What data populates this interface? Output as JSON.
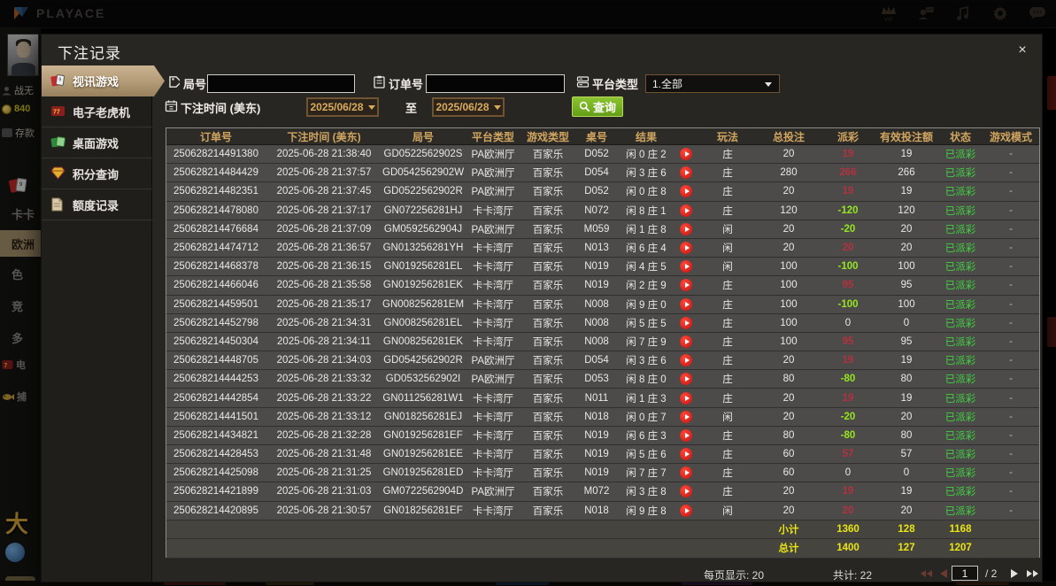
{
  "topbar": {
    "logo": "PLAYACE",
    "icons": [
      "vip-icon",
      "support-icon",
      "music-icon",
      "settings-icon",
      "chat-icon"
    ]
  },
  "sidebar": {
    "username": "战无",
    "balance": "840",
    "deposit": "存款",
    "m1": "卡卡",
    "m2": "欧洲",
    "m3": "色",
    "m4": "竞",
    "m5": "多",
    "m6": "电",
    "m7": "捕",
    "promo": "大"
  },
  "modal": {
    "title": "下注记录",
    "close_label": "×",
    "nav": [
      {
        "label": "视讯游戏",
        "active": true
      },
      {
        "label": "电子老虎机",
        "active": false
      },
      {
        "label": "桌面游戏",
        "active": false
      },
      {
        "label": "积分查询",
        "active": false
      },
      {
        "label": "额度记录",
        "active": false
      }
    ],
    "filters": {
      "round_label": "局号",
      "order_label": "订单号",
      "platform_label": "平台类型",
      "platform_value": "1.全部",
      "time_label": "下注时间 (美东)",
      "date_from": "2025/06/28",
      "to_label": "至",
      "date_to": "2025/06/28",
      "search_label": "查询"
    },
    "table": {
      "headers": [
        "订单号",
        "下注时间 (美东)",
        "局号",
        "平台类型",
        "游戏类型",
        "桌号",
        "结果",
        "",
        "玩法",
        "总投注",
        "派彩",
        "有效投注额",
        "状态",
        "游戏模式"
      ],
      "rows": [
        {
          "order": "250628214491380",
          "time": "2025-06-28 21:38:40",
          "round": "GD0522562902S",
          "platform": "PA欧洲厅",
          "game": "百家乐",
          "table": "D052",
          "result": "闲 0 庄 2",
          "play": "庄",
          "total": "20",
          "payout": "19",
          "pc": "win",
          "valid": "19",
          "status": "已派彩",
          "mode": "-"
        },
        {
          "order": "250628214484429",
          "time": "2025-06-28 21:37:57",
          "round": "GD0542562902W",
          "platform": "PA欧洲厅",
          "game": "百家乐",
          "table": "D054",
          "result": "闲 3 庄 6",
          "play": "庄",
          "total": "280",
          "payout": "266",
          "pc": "win",
          "valid": "266",
          "status": "已派彩",
          "mode": "-"
        },
        {
          "order": "250628214482351",
          "time": "2025-06-28 21:37:45",
          "round": "GD0522562902R",
          "platform": "PA欧洲厅",
          "game": "百家乐",
          "table": "D052",
          "result": "闲 0 庄 8",
          "play": "庄",
          "total": "20",
          "payout": "19",
          "pc": "win",
          "valid": "19",
          "status": "已派彩",
          "mode": "-"
        },
        {
          "order": "250628214478080",
          "time": "2025-06-28 21:37:17",
          "round": "GN072256281HJ",
          "platform": "卡卡湾厅",
          "game": "百家乐",
          "table": "N072",
          "result": "闲 8 庄 1",
          "play": "庄",
          "total": "120",
          "payout": "-120",
          "pc": "loss",
          "valid": "120",
          "status": "已派彩",
          "mode": "-"
        },
        {
          "order": "250628214476684",
          "time": "2025-06-28 21:37:09",
          "round": "GM0592562904J",
          "platform": "PA欧洲厅",
          "game": "百家乐",
          "table": "M059",
          "result": "闲 1 庄 8",
          "play": "闲",
          "total": "20",
          "payout": "-20",
          "pc": "loss",
          "valid": "20",
          "status": "已派彩",
          "mode": "-"
        },
        {
          "order": "250628214474712",
          "time": "2025-06-28 21:36:57",
          "round": "GN013256281YH",
          "platform": "卡卡湾厅",
          "game": "百家乐",
          "table": "N013",
          "result": "闲 6 庄 4",
          "play": "闲",
          "total": "20",
          "payout": "20",
          "pc": "win",
          "valid": "20",
          "status": "已派彩",
          "mode": "-"
        },
        {
          "order": "250628214468378",
          "time": "2025-06-28 21:36:15",
          "round": "GN019256281EL",
          "platform": "卡卡湾厅",
          "game": "百家乐",
          "table": "N019",
          "result": "闲 4 庄 5",
          "play": "闲",
          "total": "100",
          "payout": "-100",
          "pc": "loss",
          "valid": "100",
          "status": "已派彩",
          "mode": "-"
        },
        {
          "order": "250628214466046",
          "time": "2025-06-28 21:35:58",
          "round": "GN019256281EK",
          "platform": "卡卡湾厅",
          "game": "百家乐",
          "table": "N019",
          "result": "闲 2 庄 9",
          "play": "庄",
          "total": "100",
          "payout": "95",
          "pc": "win",
          "valid": "95",
          "status": "已派彩",
          "mode": "-"
        },
        {
          "order": "250628214459501",
          "time": "2025-06-28 21:35:17",
          "round": "GN008256281EM",
          "platform": "卡卡湾厅",
          "game": "百家乐",
          "table": "N008",
          "result": "闲 9 庄 0",
          "play": "庄",
          "total": "100",
          "payout": "-100",
          "pc": "loss",
          "valid": "100",
          "status": "已派彩",
          "mode": "-"
        },
        {
          "order": "250628214452798",
          "time": "2025-06-28 21:34:31",
          "round": "GN008256281EL",
          "platform": "卡卡湾厅",
          "game": "百家乐",
          "table": "N008",
          "result": "闲 5 庄 5",
          "play": "庄",
          "total": "100",
          "payout": "0",
          "pc": "zero",
          "valid": "0",
          "status": "已派彩",
          "mode": "-"
        },
        {
          "order": "250628214450304",
          "time": "2025-06-28 21:34:11",
          "round": "GN008256281EK",
          "platform": "卡卡湾厅",
          "game": "百家乐",
          "table": "N008",
          "result": "闲 7 庄 9",
          "play": "庄",
          "total": "100",
          "payout": "95",
          "pc": "win",
          "valid": "95",
          "status": "已派彩",
          "mode": "-"
        },
        {
          "order": "250628214448705",
          "time": "2025-06-28 21:34:03",
          "round": "GD0542562902R",
          "platform": "PA欧洲厅",
          "game": "百家乐",
          "table": "D054",
          "result": "闲 3 庄 6",
          "play": "庄",
          "total": "20",
          "payout": "19",
          "pc": "win",
          "valid": "19",
          "status": "已派彩",
          "mode": "-"
        },
        {
          "order": "250628214444253",
          "time": "2025-06-28 21:33:32",
          "round": "GD0532562902I",
          "platform": "PA欧洲厅",
          "game": "百家乐",
          "table": "D053",
          "result": "闲 8 庄 0",
          "play": "庄",
          "total": "80",
          "payout": "-80",
          "pc": "loss",
          "valid": "80",
          "status": "已派彩",
          "mode": "-"
        },
        {
          "order": "250628214442854",
          "time": "2025-06-28 21:33:22",
          "round": "GN011256281W1",
          "platform": "卡卡湾厅",
          "game": "百家乐",
          "table": "N011",
          "result": "闲 1 庄 3",
          "play": "庄",
          "total": "20",
          "payout": "19",
          "pc": "win",
          "valid": "19",
          "status": "已派彩",
          "mode": "-"
        },
        {
          "order": "250628214441501",
          "time": "2025-06-28 21:33:12",
          "round": "GN018256281EJ",
          "platform": "卡卡湾厅",
          "game": "百家乐",
          "table": "N018",
          "result": "闲 0 庄 7",
          "play": "闲",
          "total": "20",
          "payout": "-20",
          "pc": "loss",
          "valid": "20",
          "status": "已派彩",
          "mode": "-"
        },
        {
          "order": "250628214434821",
          "time": "2025-06-28 21:32:28",
          "round": "GN019256281EF",
          "platform": "卡卡湾厅",
          "game": "百家乐",
          "table": "N019",
          "result": "闲 6 庄 3",
          "play": "庄",
          "total": "80",
          "payout": "-80",
          "pc": "loss",
          "valid": "80",
          "status": "已派彩",
          "mode": "-"
        },
        {
          "order": "250628214428453",
          "time": "2025-06-28 21:31:48",
          "round": "GN019256281EE",
          "platform": "卡卡湾厅",
          "game": "百家乐",
          "table": "N019",
          "result": "闲 5 庄 6",
          "play": "庄",
          "total": "60",
          "payout": "57",
          "pc": "win",
          "valid": "57",
          "status": "已派彩",
          "mode": "-"
        },
        {
          "order": "250628214425098",
          "time": "2025-06-28 21:31:25",
          "round": "GN019256281ED",
          "platform": "卡卡湾厅",
          "game": "百家乐",
          "table": "N019",
          "result": "闲 7 庄 7",
          "play": "庄",
          "total": "60",
          "payout": "0",
          "pc": "zero",
          "valid": "0",
          "status": "已派彩",
          "mode": "-"
        },
        {
          "order": "250628214421899",
          "time": "2025-06-28 21:31:03",
          "round": "GM0722562904D",
          "platform": "PA欧洲厅",
          "game": "百家乐",
          "table": "M072",
          "result": "闲 3 庄 8",
          "play": "庄",
          "total": "20",
          "payout": "19",
          "pc": "win",
          "valid": "19",
          "status": "已派彩",
          "mode": "-"
        },
        {
          "order": "250628214420895",
          "time": "2025-06-28 21:30:57",
          "round": "GN018256281EF",
          "platform": "卡卡湾厅",
          "game": "百家乐",
          "table": "N018",
          "result": "闲 9 庄 8",
          "play": "闲",
          "total": "20",
          "payout": "20",
          "pc": "win",
          "valid": "20",
          "status": "已派彩",
          "mode": "-"
        }
      ],
      "subtotal": {
        "label": "小计",
        "total": "1360",
        "payout": "128",
        "valid": "1168"
      },
      "grand_total": {
        "label": "总计",
        "total": "1400",
        "payout": "127",
        "valid": "1207"
      }
    },
    "pager": {
      "per_page": "每页显示: 20",
      "total_count": "共计: 22",
      "page": "1",
      "page_suffix": "/ 2"
    }
  },
  "colors": {
    "accent_gold": "#d0a55f",
    "win_red": "#b23240",
    "loss_green": "#95e520",
    "status_green": "#41cf41",
    "total_yellow": "#e9e512",
    "search_green": "#77b522",
    "nav_active_tan": "#b29a76"
  }
}
